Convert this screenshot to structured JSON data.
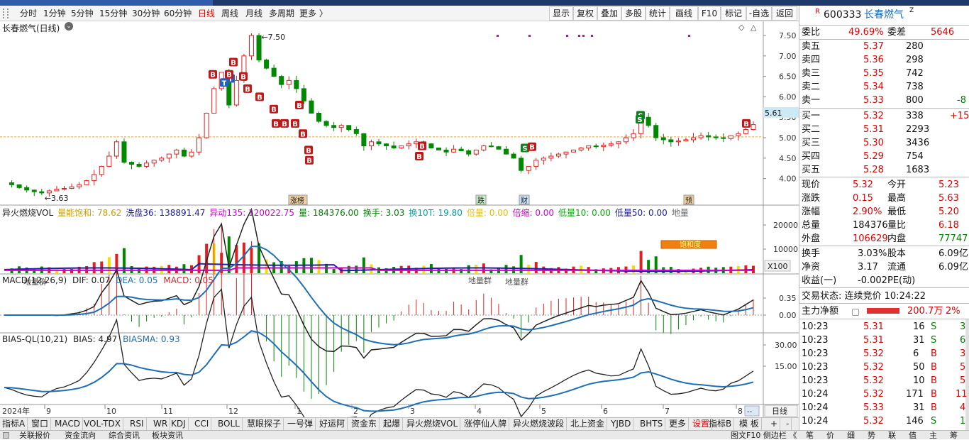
{
  "toolbar": {
    "periods": [
      "分时",
      "1分钟",
      "5分钟",
      "15分钟",
      "30分钟",
      "60分钟",
      "日线",
      "周线",
      "月线",
      "多周期",
      "更多 〉"
    ],
    "active_period": "日线",
    "buttons": [
      "显示",
      "复权",
      "叠加",
      "多股",
      "统计",
      "画线",
      "F10",
      "标记",
      "-自选",
      "返回"
    ]
  },
  "main_chart": {
    "title": "长春燃气(日线)",
    "y_ticks": [
      "7.50",
      "7.00",
      "6.50",
      "6.00",
      "5.50",
      "5.00",
      "4.50",
      "4.00"
    ],
    "current_price_tag": "5.61",
    "max_label": "7.50",
    "min_label": "3.63",
    "event_markers": [
      "涨榜",
      "跌",
      "财",
      "预"
    ],
    "signal_letters": [
      "B",
      "T",
      "S"
    ]
  },
  "vol_panel": {
    "name": "异火燃烧VOL",
    "items": [
      {
        "text": "量能饱和: 78.62",
        "color": "#c8a000"
      },
      {
        "text": "洗盘36: 138891.47",
        "color": "#1a1aa0"
      },
      {
        "text": "异动135: 120022.75",
        "color": "#d000d0"
      },
      {
        "text": "量: 184376.00",
        "color": "#008000"
      },
      {
        "text": "换手: 3.03",
        "color": "#008000"
      },
      {
        "text": "换10T: 19.80",
        "color": "#00a0a0"
      },
      {
        "text": "倍量: 0.00",
        "color": "#e0c000"
      },
      {
        "text": "倍缩: 0.00",
        "color": "#d000d0"
      },
      {
        "text": "低量10: 0.00",
        "color": "#00b000"
      },
      {
        "text": "低量50: 0.00",
        "color": "#1a1aa0"
      },
      {
        "text": "地量",
        "color": "#666666"
      }
    ],
    "y_ticks": [
      "20000",
      "10000"
    ],
    "unit": "X100",
    "label_left": "地量群",
    "label_mid": "地量群",
    "label_mid2": "地量群",
    "badge": "饱和度"
  },
  "macd_panel": {
    "title": "MACD(12,26,9)",
    "dif": "DIF: 0.07",
    "dea": "DEA: 0.05",
    "macd": "MACD: 0.05",
    "y_ticks": [
      "0.35",
      "0.00"
    ]
  },
  "bias_panel": {
    "title": "BIAS-QL(10,21)",
    "bias": "BIAS: 4.97",
    "biasma": "BIASMA: 0.93",
    "y_ticks": [
      "30.00",
      "15.00"
    ]
  },
  "x_axis": {
    "year": "2024年",
    "months": [
      "9",
      "10",
      "11",
      "12",
      "1",
      "2",
      "3",
      "4",
      "5",
      "6",
      "7",
      "8"
    ],
    "period_btn": "日线"
  },
  "bottom_tabs": [
    "指标A",
    "窗口",
    "MACD",
    "VOL-TDX",
    "RSI",
    "WR",
    "KDJ",
    "CCI",
    "BOLL",
    "慧眼探子",
    "一号弹",
    "好运阿",
    "资金东",
    "起爆",
    "异火燃烧VOL",
    "涨停仙人牌",
    "异火燃烧波段",
    "北上资金",
    "YJBD",
    "BHTS",
    "更多",
    "设置"
  ],
  "bottom_tabs_right": [
    "指标B",
    "模 板",
    "+",
    "-"
  ],
  "status_bar": {
    "items": [
      "关联报价",
      "资金流向",
      "综合资讯",
      "板块资讯"
    ],
    "right_text": "图文F10 侧边栏 《",
    "right_tabs": [
      "笔",
      "价",
      "细",
      "势",
      "联",
      "值",
      "主",
      "筹"
    ]
  },
  "quote": {
    "code": "600333",
    "name": "长春燃气",
    "weibi_label": "委比",
    "weibi": "49.69%",
    "weicha_label": "委差",
    "weicha": "5646",
    "asks": [
      {
        "label": "卖五",
        "price": "5.37",
        "vol": "280",
        "chg": ""
      },
      {
        "label": "卖四",
        "price": "5.36",
        "vol": "298",
        "chg": ""
      },
      {
        "label": "卖三",
        "price": "5.35",
        "vol": "742",
        "chg": ""
      },
      {
        "label": "卖二",
        "price": "5.34",
        "vol": "738",
        "chg": ""
      },
      {
        "label": "卖一",
        "price": "5.33",
        "vol": "800",
        "chg": "-8"
      }
    ],
    "bids": [
      {
        "label": "买一",
        "price": "5.32",
        "vol": "338",
        "chg": "+15"
      },
      {
        "label": "买二",
        "price": "5.31",
        "vol": "2293",
        "chg": ""
      },
      {
        "label": "买三",
        "price": "5.30",
        "vol": "3436",
        "chg": ""
      },
      {
        "label": "买四",
        "price": "5.29",
        "vol": "754",
        "chg": ""
      },
      {
        "label": "买五",
        "price": "5.28",
        "vol": "1683",
        "chg": ""
      }
    ],
    "stats": [
      {
        "l1": "现价",
        "v1": "5.32",
        "c1": "red",
        "l2": "今开",
        "v2": "5.23",
        "c2": "red"
      },
      {
        "l1": "涨跌",
        "v1": "0.15",
        "c1": "red",
        "l2": "最高",
        "v2": "5.63",
        "c2": "red"
      },
      {
        "l1": "涨幅",
        "v1": "2.90%",
        "c1": "red",
        "l2": "最低",
        "v2": "5.20",
        "c2": "red"
      },
      {
        "l1": "总量",
        "v1": "184376",
        "c1": "blk",
        "l2": "量比",
        "v2": "6.18",
        "c2": "red"
      },
      {
        "l1": "外盘",
        "v1": "106629",
        "c1": "red",
        "l2": "内盘",
        "v2": "77747",
        "c2": "grn"
      }
    ],
    "stats2": [
      {
        "l1": "换手",
        "v1": "3.03%",
        "l2": "股本",
        "v2": "6.09亿"
      },
      {
        "l1": "净资",
        "v1": "3.17",
        "l2": "流通",
        "v2": "6.09亿"
      },
      {
        "l1": "收益(一)",
        "v1": "-0.002",
        "l2": "PE(动)",
        "v2": ""
      }
    ],
    "trade_state": "交易状态: 连续竞价 10:24:22",
    "main_net_label": "主力净额",
    "main_net_value": "200.7万",
    "main_net_pct": "2%",
    "ticks": [
      {
        "t": "10:23",
        "p": "5.31",
        "v": "16",
        "d": "S",
        "n": "3"
      },
      {
        "t": "10:23",
        "p": "5.31",
        "v": "31",
        "d": "S",
        "n": "6"
      },
      {
        "t": "10:23",
        "p": "5.32",
        "v": "6",
        "d": "B",
        "n": "3"
      },
      {
        "t": "10:23",
        "p": "5.32",
        "v": "50",
        "d": "B",
        "n": "5"
      },
      {
        "t": "10:23",
        "p": "5.32",
        "v": "10",
        "d": "B",
        "n": "5"
      },
      {
        "t": "10:24",
        "p": "5.32",
        "v": "171",
        "d": "B",
        "n": "11"
      },
      {
        "t": "10:24",
        "p": "5.33",
        "v": "31",
        "d": "B",
        "n": "4"
      },
      {
        "t": "10:24",
        "p": "5.32",
        "v": "146",
        "d": "S",
        "n": "1"
      }
    ]
  },
  "chart_data": {
    "type": "candlestick",
    "price_range": [
      3.63,
      7.5
    ],
    "current_price": 5.61,
    "close_path": [
      3.9,
      3.85,
      3.78,
      3.72,
      3.68,
      3.65,
      3.7,
      3.74,
      3.76,
      3.8,
      3.85,
      3.95,
      4.1,
      4.3,
      4.55,
      4.9,
      4.4,
      4.35,
      4.3,
      4.38,
      4.45,
      4.5,
      4.6,
      4.7,
      4.55,
      4.65,
      5.0,
      5.6,
      6.2,
      6.6,
      5.8,
      6.4,
      7.0,
      7.5,
      6.9,
      6.7,
      6.5,
      6.3,
      6.4,
      6.2,
      5.9,
      5.6,
      5.4,
      5.3,
      5.25,
      5.3,
      5.2,
      5.1,
      4.8,
      4.9,
      4.85,
      4.8,
      4.75,
      4.8,
      4.85,
      4.9,
      4.85,
      4.75,
      4.7,
      4.65,
      4.72,
      4.68,
      4.6,
      4.7,
      4.8,
      4.78,
      4.72,
      4.6,
      4.5,
      4.2,
      4.3,
      4.45,
      4.5,
      4.55,
      4.6,
      4.65,
      4.7,
      4.75,
      4.8,
      4.78,
      4.82,
      4.85,
      4.9,
      5.0,
      5.1,
      5.5,
      5.3,
      5.0,
      4.95,
      4.9,
      4.92,
      4.95,
      5.0,
      5.05,
      5.02,
      5.0,
      4.98,
      5.05,
      5.1,
      5.2,
      5.32
    ]
  }
}
